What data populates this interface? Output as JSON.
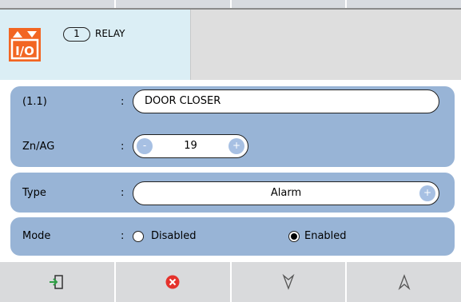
{
  "header": {
    "module_icon": "io-module-icon",
    "relay_number": "1",
    "relay_label": "RELAY"
  },
  "form": {
    "name_field": {
      "label": "(1.1)",
      "value": "DOOR CLOSER"
    },
    "zone_field": {
      "label": "Zn/AG",
      "value": "19",
      "decrement": "-",
      "increment": "+"
    },
    "type_field": {
      "label": "Type",
      "value": "Alarm",
      "increment": "+"
    },
    "mode_field": {
      "label": "Mode",
      "options": [
        {
          "label": "Disabled",
          "selected": false
        },
        {
          "label": "Enabled",
          "selected": true
        }
      ]
    },
    "separator": ":"
  },
  "toolbar": {
    "buttons": [
      {
        "icon": "exit-icon"
      },
      {
        "icon": "cancel-icon"
      },
      {
        "icon": "arrow-down-icon"
      },
      {
        "icon": "arrow-up-icon"
      }
    ]
  },
  "colors": {
    "panel": "#98b4d6",
    "header_left": "#dbeef5",
    "icon_orange": "#f26522",
    "cancel_red": "#e5322c",
    "exit_green": "#2e9e44"
  }
}
